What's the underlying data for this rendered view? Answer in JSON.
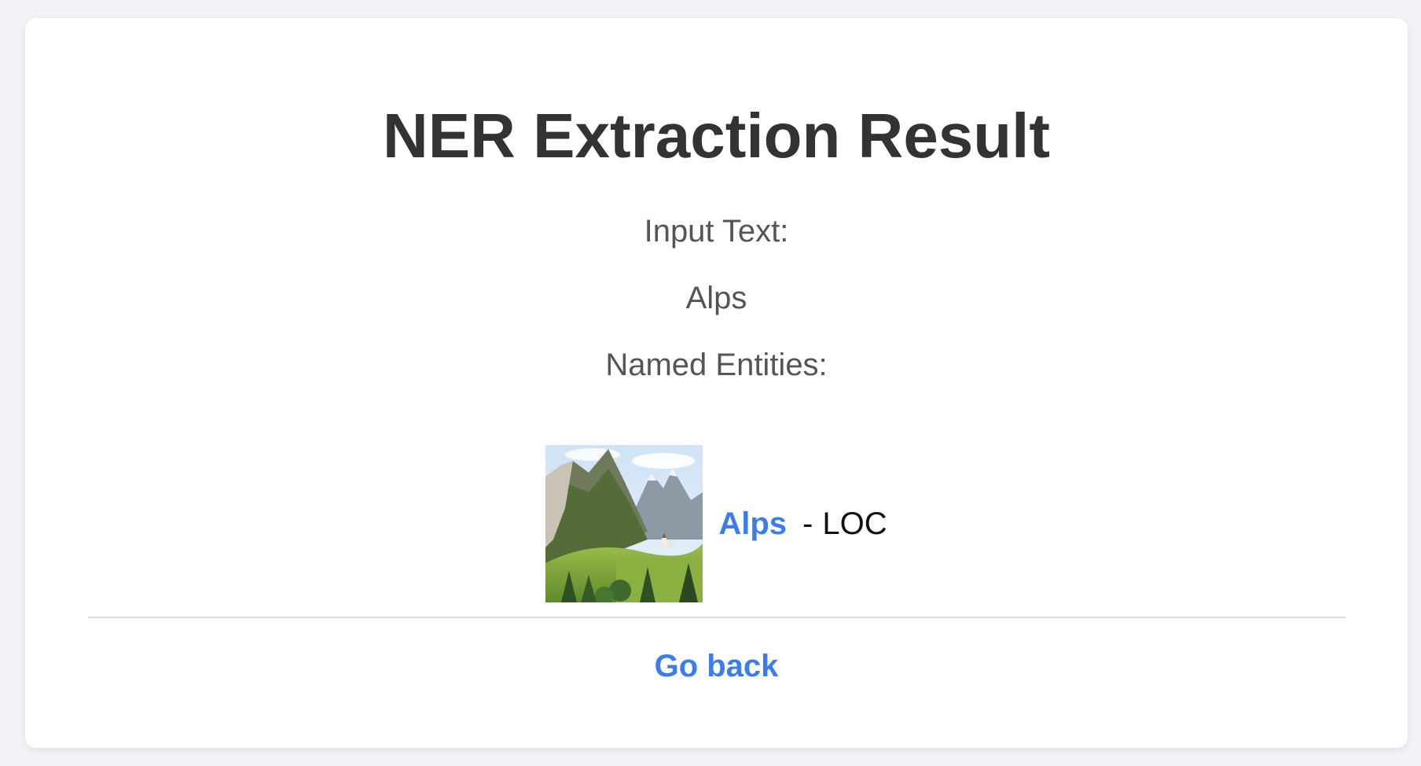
{
  "page": {
    "title": "NER Extraction Result",
    "input_label": "Input Text:",
    "input_value": "Alps",
    "entities_label": "Named Entities:",
    "back_label": "Go back"
  },
  "entities": [
    {
      "text": "Alps",
      "separator": "-",
      "type": "LOC",
      "image_icon": "mountain-landscape-thumbnail"
    }
  ],
  "colors": {
    "background": "#f3f3f7",
    "card": "#ffffff",
    "title": "#333333",
    "text": "#555555",
    "link": "#3b7ded",
    "divider": "#dcdcdc"
  }
}
